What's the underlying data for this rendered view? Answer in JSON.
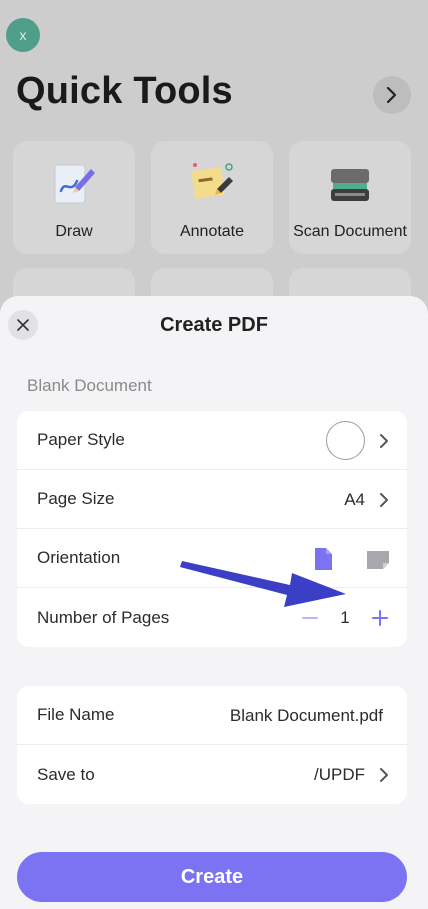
{
  "background": {
    "close_glyph": "x",
    "title": "Quick Tools",
    "tools": [
      {
        "label": "Draw",
        "icon": "pen-drawing-icon"
      },
      {
        "label": "Annotate",
        "icon": "sticky-note-icon"
      },
      {
        "label": "Scan Document",
        "icon": "scanner-icon"
      }
    ]
  },
  "sheet": {
    "title": "Create PDF",
    "section_label": "Blank Document",
    "settings": {
      "paper_style_label": "Paper Style",
      "page_size_label": "Page Size",
      "page_size_value": "A4",
      "orientation_label": "Orientation",
      "num_pages_label": "Number of Pages",
      "num_pages_value": "1"
    },
    "file": {
      "file_name_label": "File Name",
      "file_name_value": "Blank Document.pdf",
      "save_to_label": "Save to",
      "save_to_value": "/UPDF"
    },
    "create_label": "Create"
  },
  "colors": {
    "accent": "#7b73f2",
    "annotation_arrow": "#3a3fc6",
    "fab": "#4f9e8a"
  }
}
